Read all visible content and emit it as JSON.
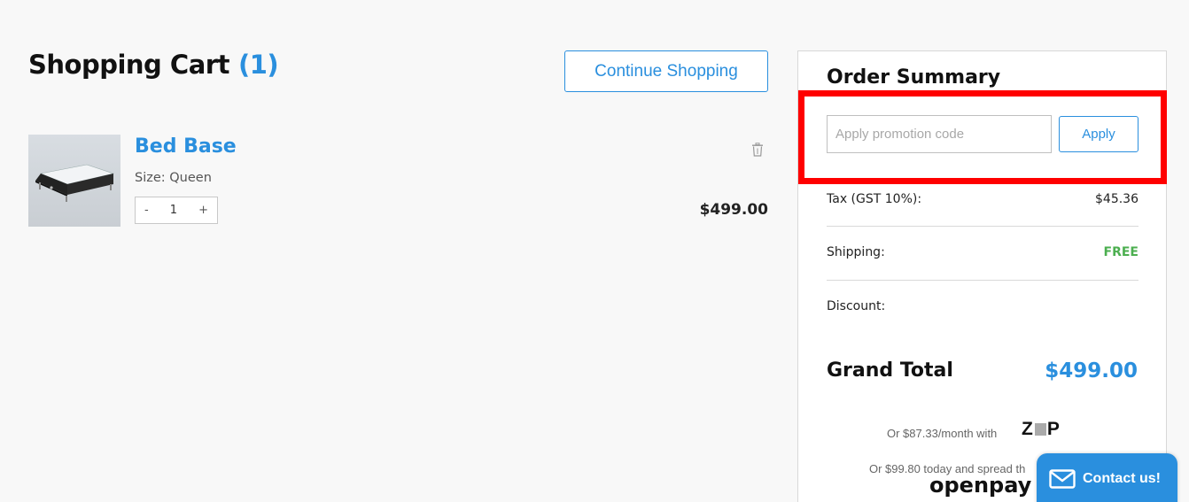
{
  "cart": {
    "title": "Shopping Cart",
    "count": "(1)",
    "continue_label": "Continue Shopping"
  },
  "item": {
    "name": "Bed Base",
    "size": "Size: Queen",
    "qty_minus": "-",
    "qty": "1",
    "qty_plus": "+",
    "price": "$499.00"
  },
  "summary": {
    "title": "Order Summary",
    "promo_placeholder": "Apply promotion code",
    "apply_label": "Apply",
    "tax_label": "Tax (GST 10%):",
    "tax_value": "$45.36",
    "shipping_label": "Shipping:",
    "shipping_value": "FREE",
    "discount_label": "Discount:",
    "grand_label": "Grand Total",
    "grand_value": "$499.00",
    "zip_text": "Or $87.33/month with",
    "zip_logo_a": "Z",
    "zip_logo_b": "P",
    "openpay_text": "Or $99.80 today and spread th",
    "openpay_logo": "openpay"
  },
  "contact": {
    "label": "Contact us!"
  },
  "colors": {
    "accent": "#2a8fde",
    "free": "#4caf50",
    "highlight": "#ff0000"
  }
}
